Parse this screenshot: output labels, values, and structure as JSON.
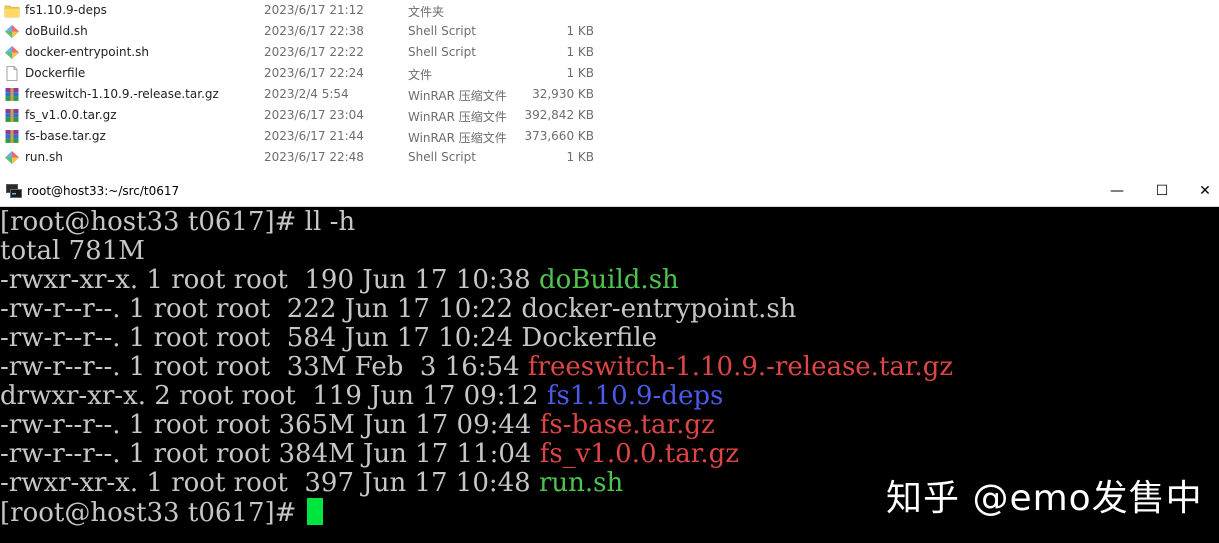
{
  "explorer": {
    "files": [
      {
        "icon": "folder-icon",
        "name": "fs1.10.9-deps",
        "date": "2023/6/17 21:12",
        "type": "文件夹",
        "size": ""
      },
      {
        "icon": "shell-script-icon",
        "name": "doBuild.sh",
        "date": "2023/6/17 22:38",
        "type": "Shell Script",
        "size": "1 KB"
      },
      {
        "icon": "shell-script-icon",
        "name": "docker-entrypoint.sh",
        "date": "2023/6/17 22:22",
        "type": "Shell Script",
        "size": "1 KB"
      },
      {
        "icon": "file-icon",
        "name": "Dockerfile",
        "date": "2023/6/17 22:24",
        "type": "文件",
        "size": "1 KB"
      },
      {
        "icon": "winrar-archive-icon",
        "name": "freeswitch-1.10.9.-release.tar.gz",
        "date": "2023/2/4 5:54",
        "type": "WinRAR 压缩文件",
        "size": "32,930 KB"
      },
      {
        "icon": "winrar-archive-icon",
        "name": "fs_v1.0.0.tar.gz",
        "date": "2023/6/17 23:04",
        "type": "WinRAR 压缩文件",
        "size": "392,842 KB"
      },
      {
        "icon": "winrar-archive-icon",
        "name": "fs-base.tar.gz",
        "date": "2023/6/17 21:44",
        "type": "WinRAR 压缩文件",
        "size": "373,660 KB"
      },
      {
        "icon": "shell-script-icon",
        "name": "run.sh",
        "date": "2023/6/17 22:48",
        "type": "Shell Script",
        "size": "1 KB"
      }
    ]
  },
  "terminal": {
    "title": "root@host33:~/src/t0617",
    "minimize_label": "—",
    "maximize_label": "☐",
    "close_label": "✕",
    "prompt_command": "[root@host33 t0617]# ll -h",
    "total": "total 781M",
    "listing": [
      {
        "meta": "-rwxr-xr-x. 1 root root  190 Jun 17 10:38 ",
        "name": "doBuild.sh",
        "color": "green"
      },
      {
        "meta": "-rw-r--r--. 1 root root  222 Jun 17 10:22 ",
        "name": "docker-entrypoint.sh",
        "color": "white"
      },
      {
        "meta": "-rw-r--r--. 1 root root  584 Jun 17 10:24 ",
        "name": "Dockerfile",
        "color": "white"
      },
      {
        "meta": "-rw-r--r--. 1 root root  33M Feb  3 16:54 ",
        "name": "freeswitch-1.10.9.-release.tar.gz",
        "color": "red"
      },
      {
        "meta": "drwxr-xr-x. 2 root root  119 Jun 17 09:12 ",
        "name": "fs1.10.9-deps",
        "color": "blue"
      },
      {
        "meta": "-rw-r--r--. 1 root root 365M Jun 17 09:44 ",
        "name": "fs-base.tar.gz",
        "color": "red"
      },
      {
        "meta": "-rw-r--r--. 1 root root 384M Jun 17 11:04 ",
        "name": "fs_v1.0.0.tar.gz",
        "color": "red"
      },
      {
        "meta": "-rwxr-xr-x. 1 root root  397 Jun 17 10:48 ",
        "name": "run.sh",
        "color": "green"
      }
    ],
    "final_prompt": "[root@host33 t0617]# ",
    "colors": {
      "green": "#4ec44e",
      "red": "#e04545",
      "blue": "#4b5ae8",
      "white": "#c6c6c6",
      "cursor": "#00e53d"
    }
  },
  "watermark": {
    "text": "知乎 @emo发售中"
  }
}
